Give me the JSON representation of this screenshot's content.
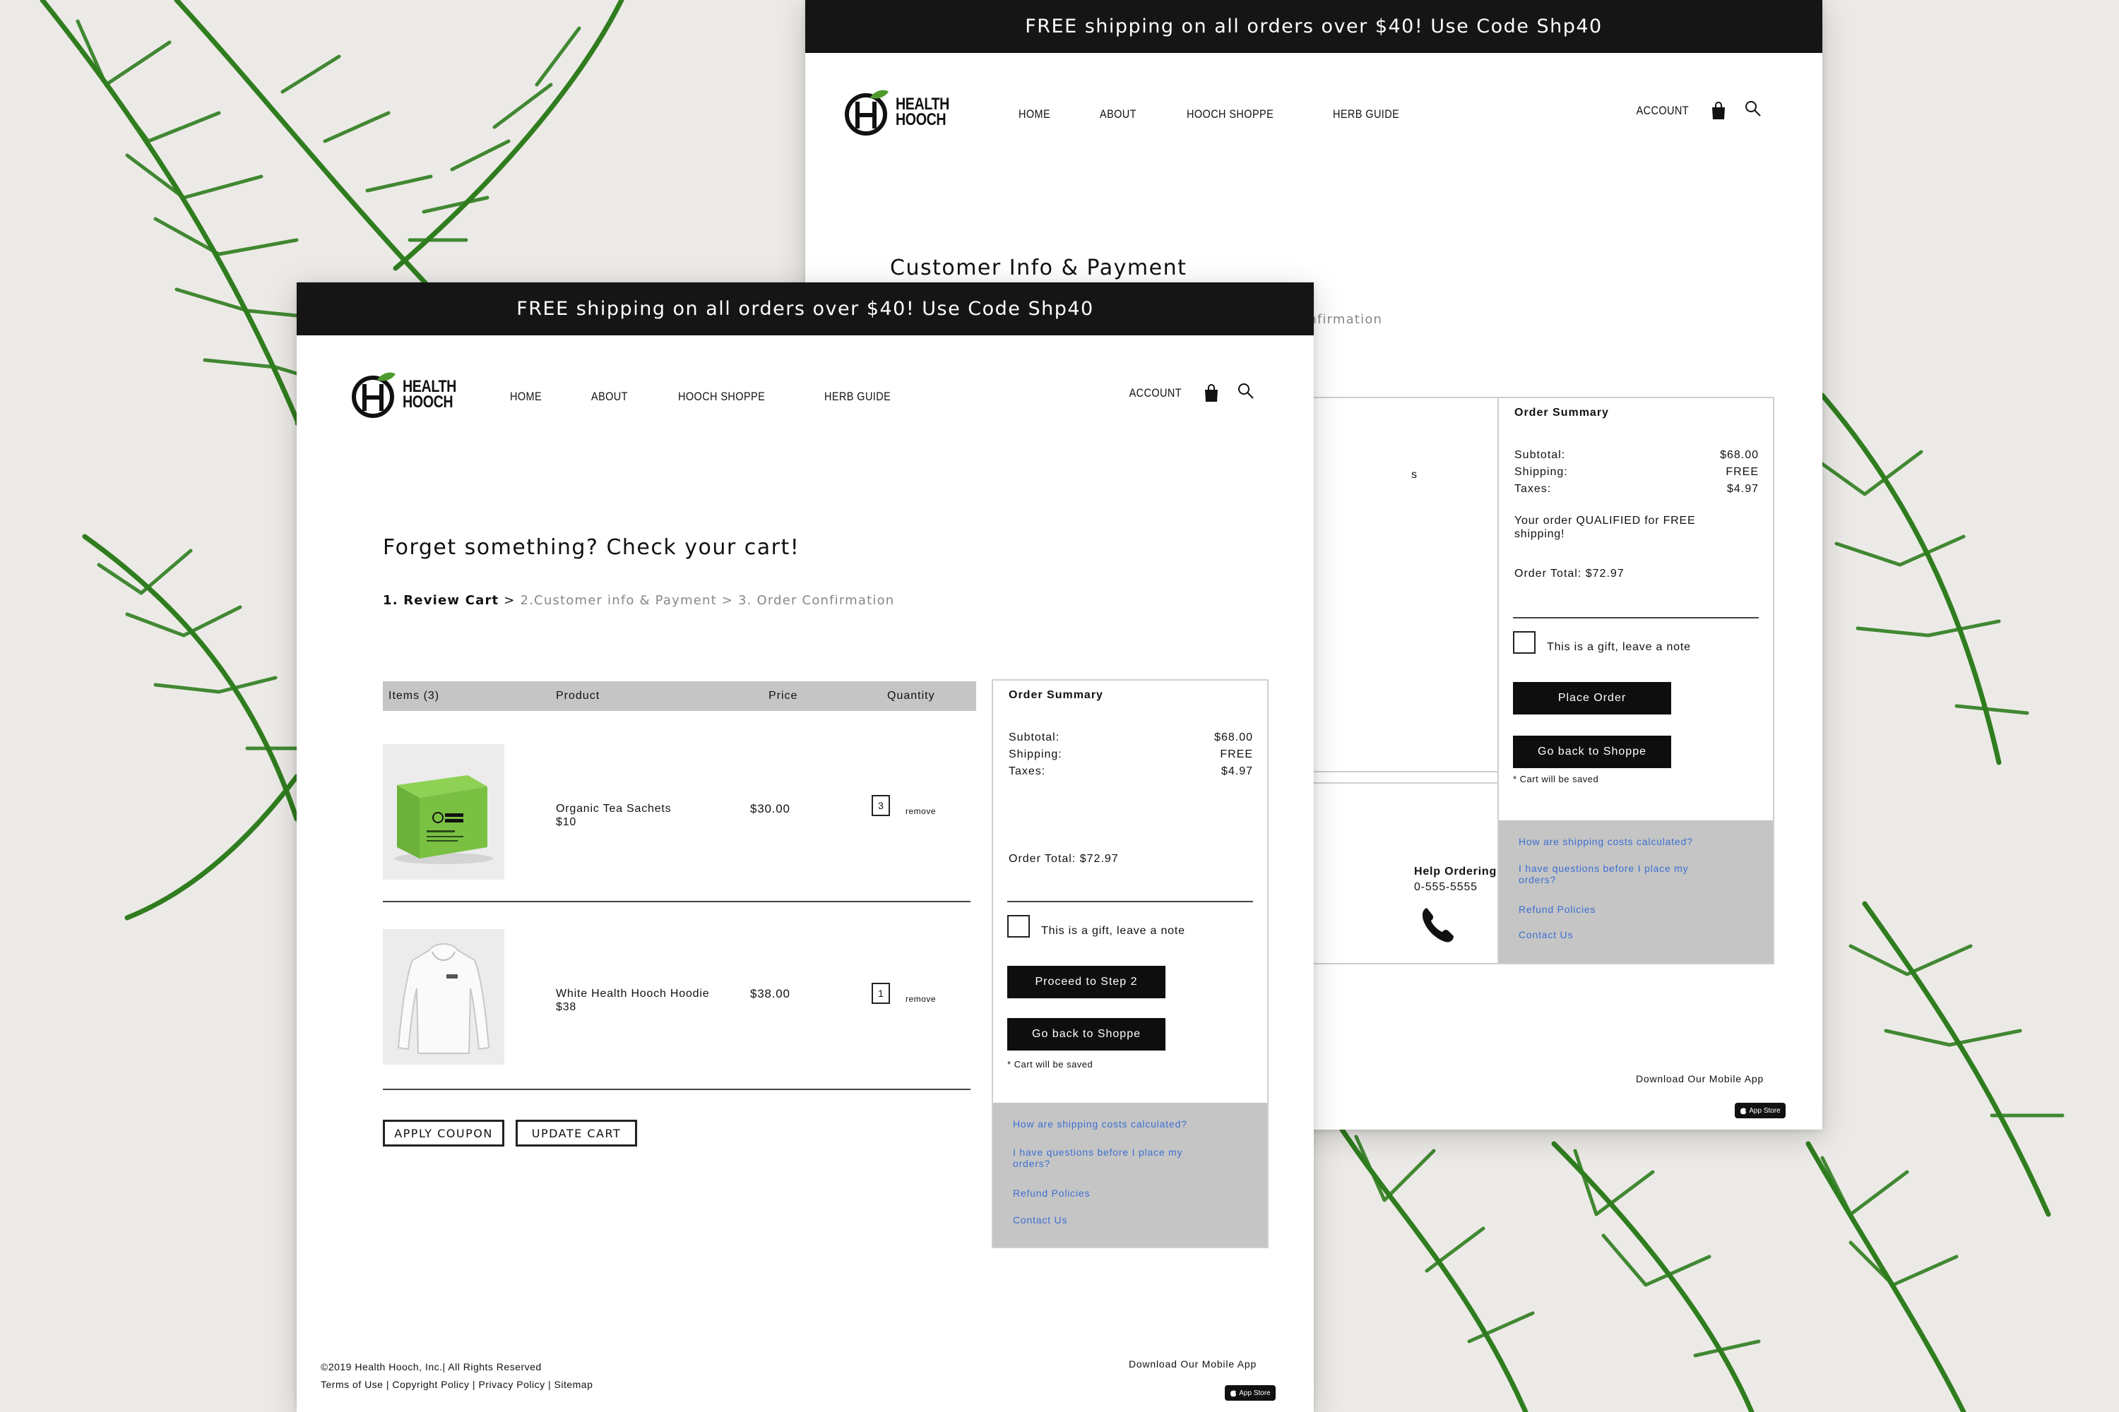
{
  "promo": {
    "text": "FREE shipping on all orders over $40! Use Code Shp40"
  },
  "logo": {
    "line1": "HEALTH",
    "line2": "HOOCH"
  },
  "nav": {
    "home": "HOME",
    "about": "ABOUT",
    "shoppe": "HOOCH SHOPPE",
    "herb_guide": "HERB GUIDE",
    "account": "ACCOUNT"
  },
  "back_page": {
    "heading": "Customer Info & Payment",
    "steps_visible": "onfirmation",
    "sidebar_fragment": "s",
    "help_ordering": "Help Ordering?",
    "phone": "0-555-5555",
    "summary": {
      "title": "Order Summary",
      "subtotal_label": "Subtotal:",
      "subtotal_value": "$68.00",
      "shipping_label": "Shipping:",
      "shipping_value": "FREE",
      "taxes_label": "Taxes:",
      "taxes_value": "$4.97",
      "qualified_note": "Your order QUALIFIED for FREE shipping!",
      "order_total": "Order Total: $72.97",
      "gift_label": "This is a gift, leave a note",
      "primary_button": "Place Order",
      "back_button": "Go back to Shoppe",
      "saved_note": "* Cart will be saved"
    },
    "help_links": [
      "How are shipping costs calculated?",
      "I have questions before I place my orders?",
      "Refund Policies",
      "Contact Us"
    ],
    "footer_download": "Download Our Mobile App"
  },
  "front_page": {
    "heading": "Forget something? Check your cart!",
    "steps": {
      "current": "1. Review Cart",
      "sep": " > ",
      "rest": "2.Customer info & Payment > 3. Order Confirmation"
    },
    "table_headers": {
      "items": "Items (3)",
      "product": "Product",
      "price": "Price",
      "quantity": "Quantity"
    },
    "rows": [
      {
        "name": "Organic Tea Sachets",
        "unit": "$10",
        "price": "$30.00",
        "qty": "3",
        "remove": "remove",
        "thumb": "green-tea-box"
      },
      {
        "name": "White Health Hooch Hoodie",
        "unit": "$38",
        "price": "$38.00",
        "qty": "1",
        "remove": "remove",
        "thumb": "white-hoodie"
      }
    ],
    "apply_coupon": "APPLY COUPON",
    "update_cart": "UPDATE CART",
    "summary": {
      "title": "Order Summary",
      "subtotal_label": "Subtotal:",
      "subtotal_value": "$68.00",
      "shipping_label": "Shipping:",
      "shipping_value": "FREE",
      "taxes_label": "Taxes:",
      "taxes_value": "$4.97",
      "order_total": "Order Total: $72.97",
      "gift_label": "This is a gift, leave a note",
      "primary_button": "Proceed to Step 2",
      "back_button": "Go back to Shoppe",
      "saved_note": "* Cart will be saved"
    },
    "help_links": [
      "How are shipping costs calculated?",
      "I have questions before I place my orders?",
      "Refund Policies",
      "Contact Us"
    ],
    "footer": {
      "copyright": "©2019 Health Hooch, Inc.|  All Rights Reserved",
      "links": "Terms of Use | Copyright Policy | Privacy Policy | Sitemap",
      "download": "Download Our Mobile App",
      "appstore": "App Store"
    }
  },
  "colors": {
    "promo_bar": "#151515",
    "link_blue": "#3d6fd1",
    "help_panel": "#c5c5c5",
    "product_green": "#7ac143",
    "leaf_green": "#2f7d1f"
  }
}
